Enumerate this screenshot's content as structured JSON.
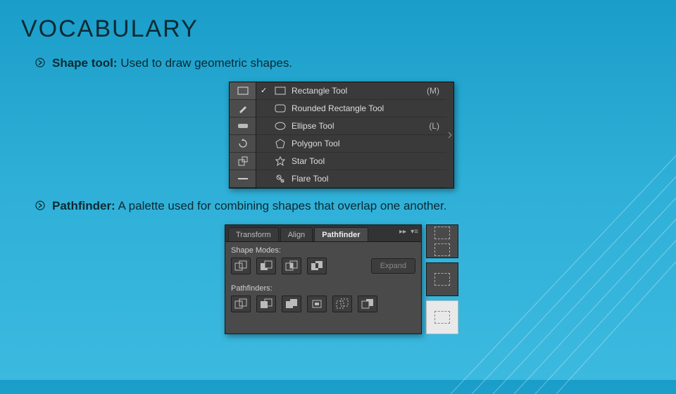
{
  "title": "VOCABULARY",
  "bullets": [
    {
      "term": "Shape tool:",
      "definition": "Used to draw geometric shapes."
    },
    {
      "term": "Pathfinder:",
      "definition": "A palette used for combining shapes that overlap one another."
    }
  ],
  "shape_tool_menu": {
    "items": [
      {
        "icon": "rectangle",
        "label": "Rectangle Tool",
        "shortcut": "(M)",
        "selected": true
      },
      {
        "icon": "rounded-rectangle",
        "label": "Rounded Rectangle Tool",
        "shortcut": "",
        "selected": false
      },
      {
        "icon": "ellipse",
        "label": "Ellipse Tool",
        "shortcut": "(L)",
        "selected": false
      },
      {
        "icon": "polygon",
        "label": "Polygon Tool",
        "shortcut": "",
        "selected": false
      },
      {
        "icon": "star",
        "label": "Star Tool",
        "shortcut": "",
        "selected": false
      },
      {
        "icon": "flare",
        "label": "Flare Tool",
        "shortcut": "",
        "selected": false
      }
    ]
  },
  "pathfinder_panel": {
    "tabs": [
      {
        "label": "Transform",
        "active": false
      },
      {
        "label": "Align",
        "active": false
      },
      {
        "label": "Pathfinder",
        "active": true
      }
    ],
    "section_modes": "Shape Modes:",
    "expand_label": "Expand",
    "section_pathfinders": "Pathfinders:",
    "mode_icons": [
      "unite",
      "minus-front",
      "intersect",
      "exclude"
    ],
    "pathfinder_icons": [
      "divide",
      "trim",
      "merge",
      "crop",
      "outline",
      "minus-back"
    ]
  }
}
